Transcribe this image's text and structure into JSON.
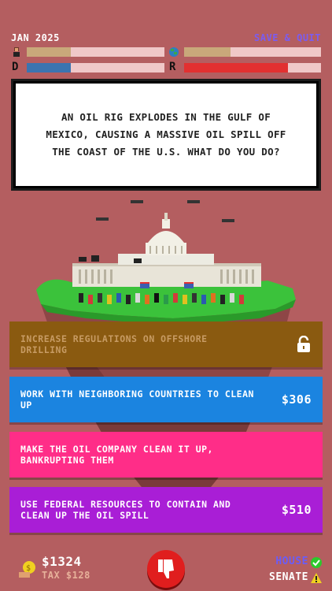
{
  "header": {
    "date": "JAN 2025",
    "save_quit": "SAVE & QUIT",
    "party_d": "D",
    "party_r": "R",
    "meters": {
      "people_approval": 0.32,
      "earth_approval": 0.34,
      "democrat_approval": 0.32,
      "republican_approval": 0.76
    }
  },
  "question": "AN OIL RIG EXPLODES IN THE GULF OF MEXICO, CAUSING A MASSIVE OIL SPILL OFF THE COAST OF THE U.S. WHAT DO YOU DO?",
  "options": [
    {
      "text": "INCREASE REGULATIONS ON OFFSHORE DRILLING",
      "cost": "",
      "icon": "unlock-icon",
      "locked": true
    },
    {
      "text": "WORK WITH NEIGHBORING COUNTRIES TO CLEAN UP",
      "cost": "$306"
    },
    {
      "text": "MAKE THE OIL COMPANY CLEAN IT UP, BANKRUPTING THEM",
      "cost": ""
    },
    {
      "text": "USE FEDERAL RESOURCES TO CONTAIN AND CLEAN UP THE OIL SPILL",
      "cost": "$510"
    }
  ],
  "footer": {
    "money": "$1324",
    "tax": "TAX $128",
    "house": "HOUSE",
    "senate": "SENATE"
  },
  "colors": {
    "background": "#b45e60",
    "option_locked": "#8a5a10",
    "option_blue": "#1b84e0",
    "option_pink": "#ff2d88",
    "option_purple": "#a91ed6",
    "democrat": "#3b74b0",
    "republican": "#e23030"
  }
}
